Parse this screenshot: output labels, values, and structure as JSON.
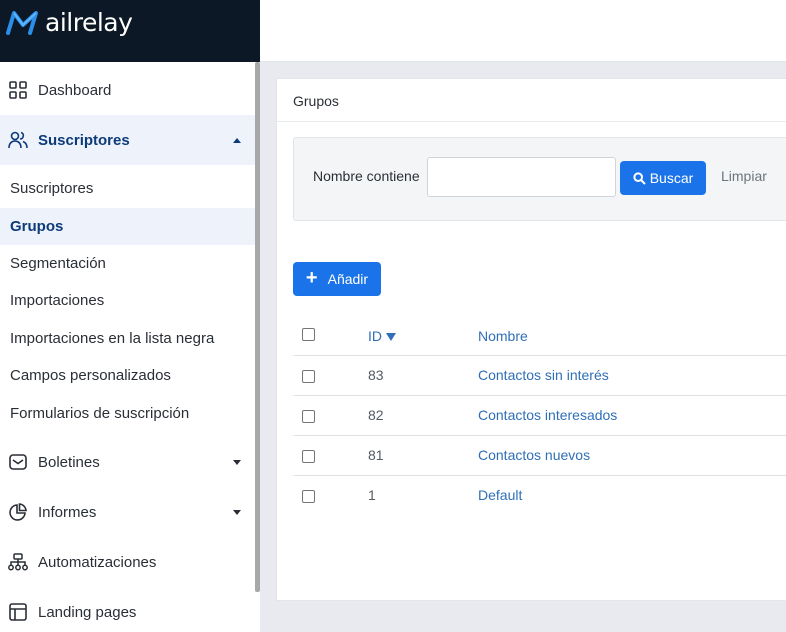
{
  "brand": {
    "logo_text": "ailrelay"
  },
  "sidebar": {
    "items": [
      {
        "label": "Dashboard",
        "icon": "grid-icon"
      },
      {
        "label": "Suscriptores",
        "icon": "users-icon",
        "expanded": true
      },
      {
        "label": "Boletines",
        "icon": "envelope-icon"
      },
      {
        "label": "Informes",
        "icon": "pie-chart-icon"
      },
      {
        "label": "Automatizaciones",
        "icon": "sitemap-icon"
      },
      {
        "label": "Landing pages",
        "icon": "layout-icon"
      }
    ],
    "sub_items": [
      {
        "label": "Suscriptores"
      },
      {
        "label": "Grupos",
        "active": true
      },
      {
        "label": "Segmentación"
      },
      {
        "label": "Importaciones"
      },
      {
        "label": "Importaciones en la lista negra"
      },
      {
        "label": "Campos personalizados"
      },
      {
        "label": "Formularios de suscripción"
      }
    ]
  },
  "breadcrumb": "Grupos",
  "filter": {
    "label": "Nombre contiene",
    "input_value": "",
    "search_button": "Buscar",
    "clear_link": "Limpiar"
  },
  "add_button": "Añadir",
  "table": {
    "columns": {
      "id": "ID",
      "name": "Nombre"
    },
    "sort": {
      "column": "ID",
      "direction": "desc"
    },
    "rows": [
      {
        "id": "83",
        "name": "Contactos sin interés"
      },
      {
        "id": "82",
        "name": "Contactos interesados"
      },
      {
        "id": "81",
        "name": "Contactos nuevos"
      },
      {
        "id": "1",
        "name": "Default"
      }
    ]
  },
  "colors": {
    "primary": "#1a73e8",
    "sidebar_dark": "#0d1826",
    "active_text": "#0d3b7a",
    "link": "#2f6fb7"
  }
}
